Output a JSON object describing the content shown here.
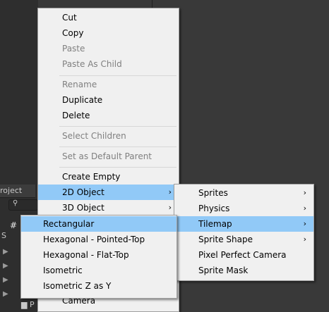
{
  "background": {
    "project_tab": "roject",
    "search_icon": "search-icon",
    "tree_s": "S",
    "tree_hash": "#",
    "tree_folder": "P"
  },
  "main_menu": {
    "items": [
      {
        "label": "Cut",
        "enabled": true
      },
      {
        "label": "Copy",
        "enabled": true
      },
      {
        "label": "Paste",
        "enabled": false
      },
      {
        "label": "Paste As Child",
        "enabled": false
      },
      {
        "label": "Rename",
        "enabled": false
      },
      {
        "label": "Duplicate",
        "enabled": true
      },
      {
        "label": "Delete",
        "enabled": true
      },
      {
        "label": "Select Children",
        "enabled": false
      },
      {
        "label": "Set as Default Parent",
        "enabled": false
      },
      {
        "label": "Create Empty",
        "enabled": true
      },
      {
        "label": "2D Object",
        "enabled": true,
        "submenu": true,
        "highlighted": true
      },
      {
        "label": "3D Object",
        "enabled": true,
        "submenu": true
      },
      {
        "label": "Camera",
        "enabled": true
      }
    ]
  },
  "submenu_2d": {
    "items": [
      {
        "label": "Sprites",
        "submenu": true
      },
      {
        "label": "Physics",
        "submenu": true
      },
      {
        "label": "Tilemap",
        "submenu": true,
        "highlighted": true
      },
      {
        "label": "Sprite Shape",
        "submenu": true
      },
      {
        "label": "Pixel Perfect Camera"
      },
      {
        "label": "Sprite Mask"
      }
    ]
  },
  "submenu_tilemap": {
    "items": [
      {
        "label": "Rectangular",
        "highlighted": true
      },
      {
        "label": "Hexagonal - Pointed-Top"
      },
      {
        "label": "Hexagonal - Flat-Top"
      },
      {
        "label": "Isometric"
      },
      {
        "label": "Isometric Z as Y"
      }
    ]
  },
  "colors": {
    "menu_bg": "#f0f0f0",
    "highlight": "#91c9f7",
    "disabled_text": "#808080",
    "editor_bg": "#383838"
  },
  "submenu_arrow": "›"
}
